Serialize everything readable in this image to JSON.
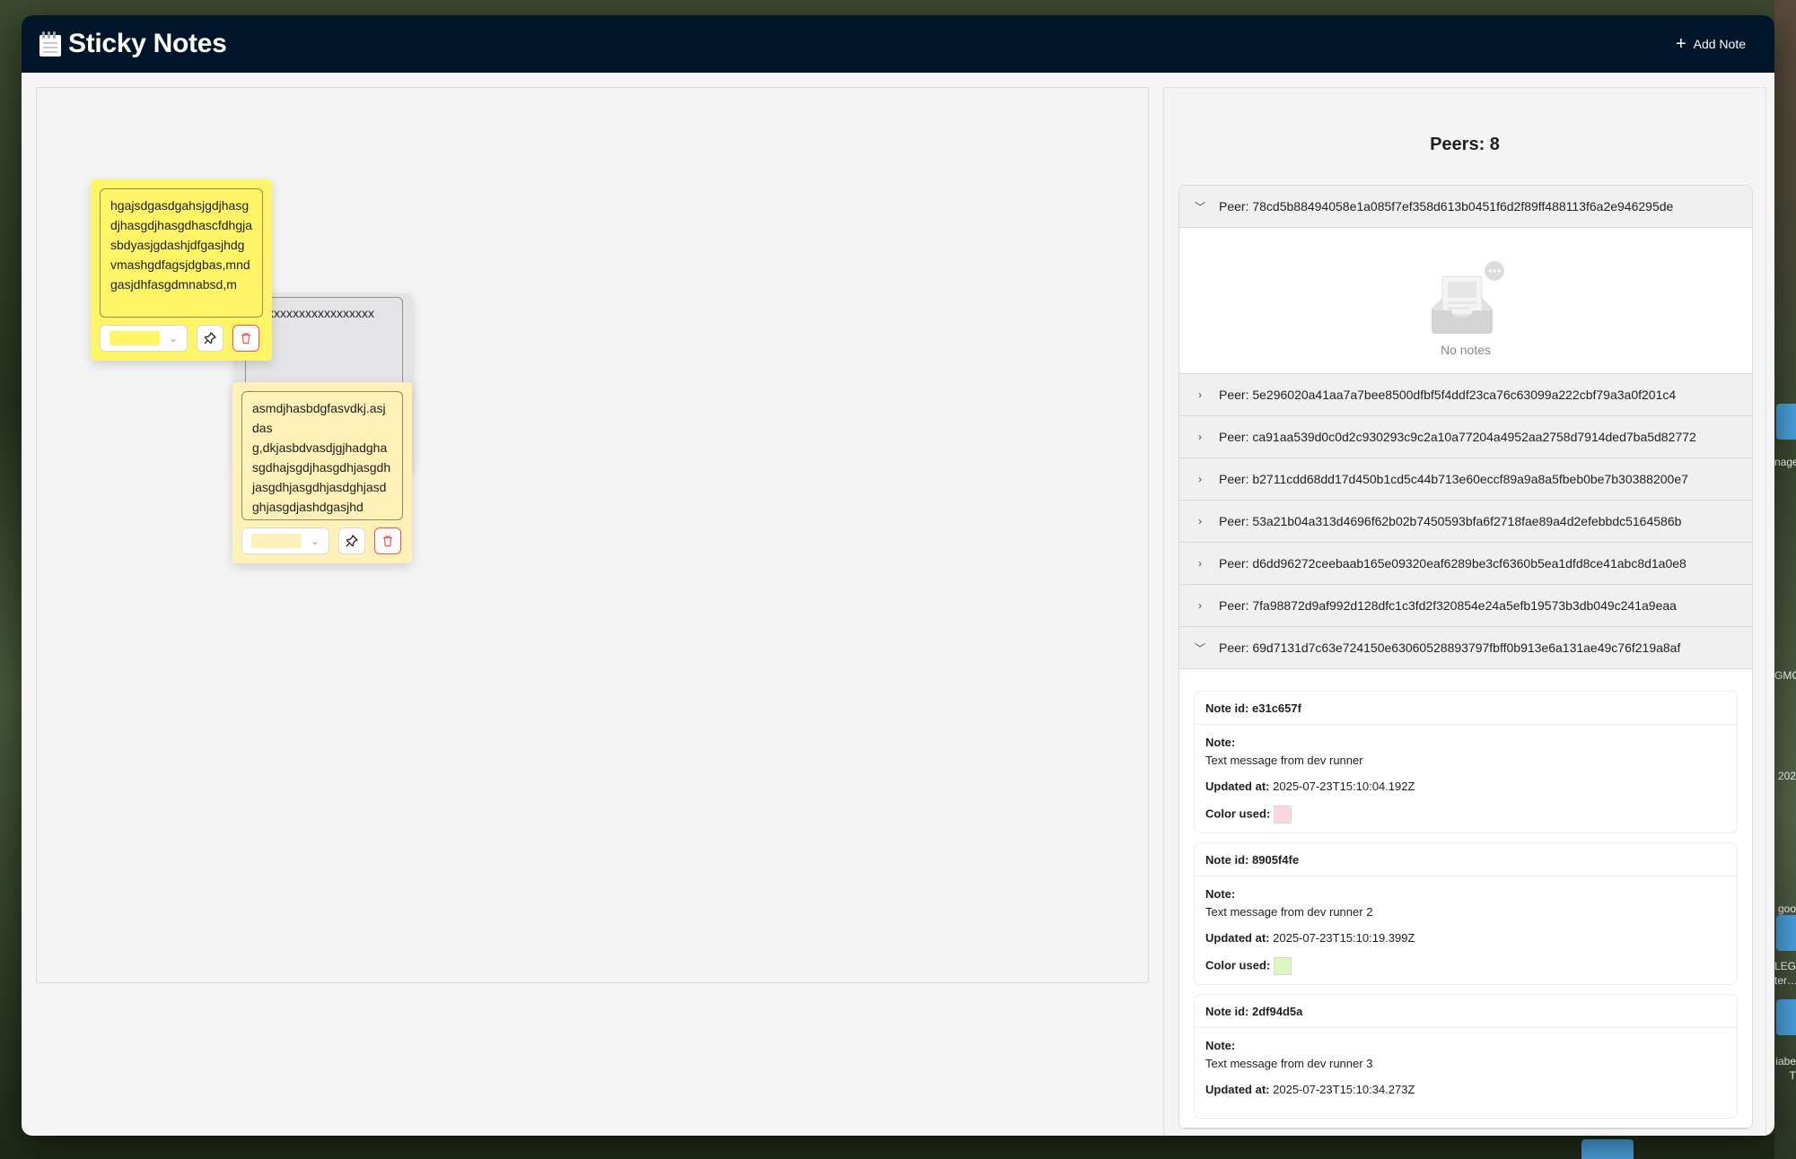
{
  "app": {
    "title": "Sticky Notes",
    "add_note_label": "Add Note"
  },
  "board": {
    "notes": [
      {
        "text": "hgajsdgasdgahsjgdjhasgdjhasgdjhasgdhascfdhgjasbdyasjgdashjdfgasjhdg\nvmashgdfagsjdgbas,mndgasjdhfasgdmnabsd,m",
        "color": "#fff566"
      },
      {
        "text": "xxxxxxxxxxxxxxxxx",
        "color": "#e4e4e6"
      },
      {
        "text": "asmdjhasbdgfasvdkj.asjdas\ng,dkjasbdvasdjgjhadghasgdhajsgdjhasgdhjasgdhjasgdhjasgdhjasdghjasdghjasgdjashdgasjhd",
        "color": "#fff1b8"
      }
    ]
  },
  "panel": {
    "peers_title": "Peers: 8",
    "empty_text": "No notes",
    "peers": [
      {
        "label": "Peer: 78cd5b88494058e1a085f7ef358d613b0451f6d2f89ff488113f6a2e946295de",
        "expanded": true
      },
      {
        "label": "Peer: 5e296020a41aa7a7bee8500dfbf5f4ddf23ca76c63099a222cbf79a3a0f201c4",
        "expanded": false
      },
      {
        "label": "Peer: ca91aa539d0c0d2c930293c9c2a10a77204a4952aa2758d7914ded7ba5d82772",
        "expanded": false
      },
      {
        "label": "Peer: b2711cdd68dd17d450b1cd5c44b713e60eccf89a9a8a5fbeb0be7b30388200e7",
        "expanded": false
      },
      {
        "label": "Peer: 53a21b04a313d4696f62b02b7450593bfa6f2718fae89a4d2efebbdc5164586b",
        "expanded": false
      },
      {
        "label": "Peer: d6dd96272ceebaab165e09320eaf6289be3cf6360b5ea1dfd8ce41abc8d1a0e8",
        "expanded": false
      },
      {
        "label": "Peer: 7fa98872d9af992d128dfc1c3fd2f320854e24a5efb19573b3db049c241a9eaa",
        "expanded": false
      },
      {
        "label": "Peer: 69d7131d7c63e724150e63060528893797fbff0b913e6a131ae49c76f219a8af",
        "expanded": true
      }
    ],
    "note_labels": {
      "note_id": "Note id:",
      "note": "Note:",
      "updated_at": "Updated at:",
      "color_used": "Color used:"
    },
    "notes": [
      {
        "id": "e31c657f",
        "text": "Text message from dev runner",
        "updated": "2025-07-23T15:10:04.192Z",
        "color": "#ffd6de"
      },
      {
        "id": "8905f4fe",
        "text": "Text message from dev runner 2",
        "updated": "2025-07-23T15:10:19.399Z",
        "color": "#d9f7be"
      },
      {
        "id": "2df94d5a",
        "text": "Text message from dev runner 3",
        "updated": "2025-07-23T15:10:34.273Z",
        "color": ""
      }
    ]
  },
  "desktop": {
    "labels": [
      "nage",
      "GMO",
      "202",
      "goo",
      "LEG",
      "ter…",
      "iabe",
      "T"
    ]
  }
}
